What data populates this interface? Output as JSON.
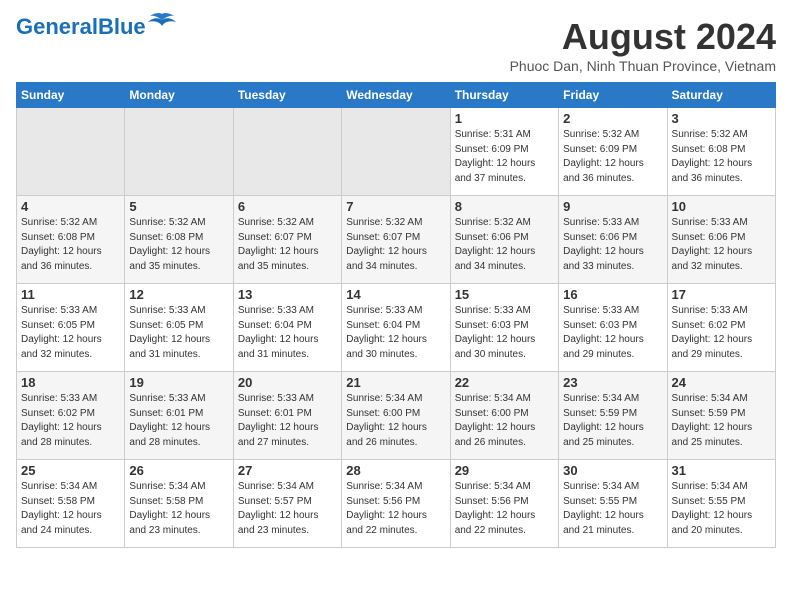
{
  "header": {
    "logo_general": "General",
    "logo_blue": "Blue",
    "month_year": "August 2024",
    "location": "Phuoc Dan, Ninh Thuan Province, Vietnam"
  },
  "calendar": {
    "days_of_week": [
      "Sunday",
      "Monday",
      "Tuesday",
      "Wednesday",
      "Thursday",
      "Friday",
      "Saturday"
    ],
    "weeks": [
      [
        {
          "day": "",
          "info": ""
        },
        {
          "day": "",
          "info": ""
        },
        {
          "day": "",
          "info": ""
        },
        {
          "day": "",
          "info": ""
        },
        {
          "day": "1",
          "info": "Sunrise: 5:31 AM\nSunset: 6:09 PM\nDaylight: 12 hours\nand 37 minutes."
        },
        {
          "day": "2",
          "info": "Sunrise: 5:32 AM\nSunset: 6:09 PM\nDaylight: 12 hours\nand 36 minutes."
        },
        {
          "day": "3",
          "info": "Sunrise: 5:32 AM\nSunset: 6:08 PM\nDaylight: 12 hours\nand 36 minutes."
        }
      ],
      [
        {
          "day": "4",
          "info": "Sunrise: 5:32 AM\nSunset: 6:08 PM\nDaylight: 12 hours\nand 36 minutes."
        },
        {
          "day": "5",
          "info": "Sunrise: 5:32 AM\nSunset: 6:08 PM\nDaylight: 12 hours\nand 35 minutes."
        },
        {
          "day": "6",
          "info": "Sunrise: 5:32 AM\nSunset: 6:07 PM\nDaylight: 12 hours\nand 35 minutes."
        },
        {
          "day": "7",
          "info": "Sunrise: 5:32 AM\nSunset: 6:07 PM\nDaylight: 12 hours\nand 34 minutes."
        },
        {
          "day": "8",
          "info": "Sunrise: 5:32 AM\nSunset: 6:06 PM\nDaylight: 12 hours\nand 34 minutes."
        },
        {
          "day": "9",
          "info": "Sunrise: 5:33 AM\nSunset: 6:06 PM\nDaylight: 12 hours\nand 33 minutes."
        },
        {
          "day": "10",
          "info": "Sunrise: 5:33 AM\nSunset: 6:06 PM\nDaylight: 12 hours\nand 32 minutes."
        }
      ],
      [
        {
          "day": "11",
          "info": "Sunrise: 5:33 AM\nSunset: 6:05 PM\nDaylight: 12 hours\nand 32 minutes."
        },
        {
          "day": "12",
          "info": "Sunrise: 5:33 AM\nSunset: 6:05 PM\nDaylight: 12 hours\nand 31 minutes."
        },
        {
          "day": "13",
          "info": "Sunrise: 5:33 AM\nSunset: 6:04 PM\nDaylight: 12 hours\nand 31 minutes."
        },
        {
          "day": "14",
          "info": "Sunrise: 5:33 AM\nSunset: 6:04 PM\nDaylight: 12 hours\nand 30 minutes."
        },
        {
          "day": "15",
          "info": "Sunrise: 5:33 AM\nSunset: 6:03 PM\nDaylight: 12 hours\nand 30 minutes."
        },
        {
          "day": "16",
          "info": "Sunrise: 5:33 AM\nSunset: 6:03 PM\nDaylight: 12 hours\nand 29 minutes."
        },
        {
          "day": "17",
          "info": "Sunrise: 5:33 AM\nSunset: 6:02 PM\nDaylight: 12 hours\nand 29 minutes."
        }
      ],
      [
        {
          "day": "18",
          "info": "Sunrise: 5:33 AM\nSunset: 6:02 PM\nDaylight: 12 hours\nand 28 minutes."
        },
        {
          "day": "19",
          "info": "Sunrise: 5:33 AM\nSunset: 6:01 PM\nDaylight: 12 hours\nand 28 minutes."
        },
        {
          "day": "20",
          "info": "Sunrise: 5:33 AM\nSunset: 6:01 PM\nDaylight: 12 hours\nand 27 minutes."
        },
        {
          "day": "21",
          "info": "Sunrise: 5:34 AM\nSunset: 6:00 PM\nDaylight: 12 hours\nand 26 minutes."
        },
        {
          "day": "22",
          "info": "Sunrise: 5:34 AM\nSunset: 6:00 PM\nDaylight: 12 hours\nand 26 minutes."
        },
        {
          "day": "23",
          "info": "Sunrise: 5:34 AM\nSunset: 5:59 PM\nDaylight: 12 hours\nand 25 minutes."
        },
        {
          "day": "24",
          "info": "Sunrise: 5:34 AM\nSunset: 5:59 PM\nDaylight: 12 hours\nand 25 minutes."
        }
      ],
      [
        {
          "day": "25",
          "info": "Sunrise: 5:34 AM\nSunset: 5:58 PM\nDaylight: 12 hours\nand 24 minutes."
        },
        {
          "day": "26",
          "info": "Sunrise: 5:34 AM\nSunset: 5:58 PM\nDaylight: 12 hours\nand 23 minutes."
        },
        {
          "day": "27",
          "info": "Sunrise: 5:34 AM\nSunset: 5:57 PM\nDaylight: 12 hours\nand 23 minutes."
        },
        {
          "day": "28",
          "info": "Sunrise: 5:34 AM\nSunset: 5:56 PM\nDaylight: 12 hours\nand 22 minutes."
        },
        {
          "day": "29",
          "info": "Sunrise: 5:34 AM\nSunset: 5:56 PM\nDaylight: 12 hours\nand 22 minutes."
        },
        {
          "day": "30",
          "info": "Sunrise: 5:34 AM\nSunset: 5:55 PM\nDaylight: 12 hours\nand 21 minutes."
        },
        {
          "day": "31",
          "info": "Sunrise: 5:34 AM\nSunset: 5:55 PM\nDaylight: 12 hours\nand 20 minutes."
        }
      ]
    ]
  }
}
